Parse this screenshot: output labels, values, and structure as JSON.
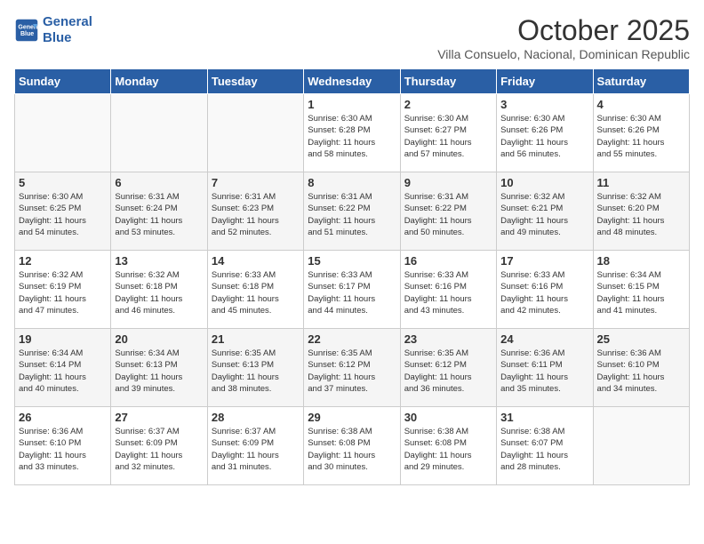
{
  "header": {
    "logo_line1": "General",
    "logo_line2": "Blue",
    "month": "October 2025",
    "location": "Villa Consuelo, Nacional, Dominican Republic"
  },
  "days_of_week": [
    "Sunday",
    "Monday",
    "Tuesday",
    "Wednesday",
    "Thursday",
    "Friday",
    "Saturday"
  ],
  "weeks": [
    [
      {
        "day": "",
        "info": ""
      },
      {
        "day": "",
        "info": ""
      },
      {
        "day": "",
        "info": ""
      },
      {
        "day": "1",
        "info": "Sunrise: 6:30 AM\nSunset: 6:28 PM\nDaylight: 11 hours\nand 58 minutes."
      },
      {
        "day": "2",
        "info": "Sunrise: 6:30 AM\nSunset: 6:27 PM\nDaylight: 11 hours\nand 57 minutes."
      },
      {
        "day": "3",
        "info": "Sunrise: 6:30 AM\nSunset: 6:26 PM\nDaylight: 11 hours\nand 56 minutes."
      },
      {
        "day": "4",
        "info": "Sunrise: 6:30 AM\nSunset: 6:26 PM\nDaylight: 11 hours\nand 55 minutes."
      }
    ],
    [
      {
        "day": "5",
        "info": "Sunrise: 6:30 AM\nSunset: 6:25 PM\nDaylight: 11 hours\nand 54 minutes."
      },
      {
        "day": "6",
        "info": "Sunrise: 6:31 AM\nSunset: 6:24 PM\nDaylight: 11 hours\nand 53 minutes."
      },
      {
        "day": "7",
        "info": "Sunrise: 6:31 AM\nSunset: 6:23 PM\nDaylight: 11 hours\nand 52 minutes."
      },
      {
        "day": "8",
        "info": "Sunrise: 6:31 AM\nSunset: 6:22 PM\nDaylight: 11 hours\nand 51 minutes."
      },
      {
        "day": "9",
        "info": "Sunrise: 6:31 AM\nSunset: 6:22 PM\nDaylight: 11 hours\nand 50 minutes."
      },
      {
        "day": "10",
        "info": "Sunrise: 6:32 AM\nSunset: 6:21 PM\nDaylight: 11 hours\nand 49 minutes."
      },
      {
        "day": "11",
        "info": "Sunrise: 6:32 AM\nSunset: 6:20 PM\nDaylight: 11 hours\nand 48 minutes."
      }
    ],
    [
      {
        "day": "12",
        "info": "Sunrise: 6:32 AM\nSunset: 6:19 PM\nDaylight: 11 hours\nand 47 minutes."
      },
      {
        "day": "13",
        "info": "Sunrise: 6:32 AM\nSunset: 6:18 PM\nDaylight: 11 hours\nand 46 minutes."
      },
      {
        "day": "14",
        "info": "Sunrise: 6:33 AM\nSunset: 6:18 PM\nDaylight: 11 hours\nand 45 minutes."
      },
      {
        "day": "15",
        "info": "Sunrise: 6:33 AM\nSunset: 6:17 PM\nDaylight: 11 hours\nand 44 minutes."
      },
      {
        "day": "16",
        "info": "Sunrise: 6:33 AM\nSunset: 6:16 PM\nDaylight: 11 hours\nand 43 minutes."
      },
      {
        "day": "17",
        "info": "Sunrise: 6:33 AM\nSunset: 6:16 PM\nDaylight: 11 hours\nand 42 minutes."
      },
      {
        "day": "18",
        "info": "Sunrise: 6:34 AM\nSunset: 6:15 PM\nDaylight: 11 hours\nand 41 minutes."
      }
    ],
    [
      {
        "day": "19",
        "info": "Sunrise: 6:34 AM\nSunset: 6:14 PM\nDaylight: 11 hours\nand 40 minutes."
      },
      {
        "day": "20",
        "info": "Sunrise: 6:34 AM\nSunset: 6:13 PM\nDaylight: 11 hours\nand 39 minutes."
      },
      {
        "day": "21",
        "info": "Sunrise: 6:35 AM\nSunset: 6:13 PM\nDaylight: 11 hours\nand 38 minutes."
      },
      {
        "day": "22",
        "info": "Sunrise: 6:35 AM\nSunset: 6:12 PM\nDaylight: 11 hours\nand 37 minutes."
      },
      {
        "day": "23",
        "info": "Sunrise: 6:35 AM\nSunset: 6:12 PM\nDaylight: 11 hours\nand 36 minutes."
      },
      {
        "day": "24",
        "info": "Sunrise: 6:36 AM\nSunset: 6:11 PM\nDaylight: 11 hours\nand 35 minutes."
      },
      {
        "day": "25",
        "info": "Sunrise: 6:36 AM\nSunset: 6:10 PM\nDaylight: 11 hours\nand 34 minutes."
      }
    ],
    [
      {
        "day": "26",
        "info": "Sunrise: 6:36 AM\nSunset: 6:10 PM\nDaylight: 11 hours\nand 33 minutes."
      },
      {
        "day": "27",
        "info": "Sunrise: 6:37 AM\nSunset: 6:09 PM\nDaylight: 11 hours\nand 32 minutes."
      },
      {
        "day": "28",
        "info": "Sunrise: 6:37 AM\nSunset: 6:09 PM\nDaylight: 11 hours\nand 31 minutes."
      },
      {
        "day": "29",
        "info": "Sunrise: 6:38 AM\nSunset: 6:08 PM\nDaylight: 11 hours\nand 30 minutes."
      },
      {
        "day": "30",
        "info": "Sunrise: 6:38 AM\nSunset: 6:08 PM\nDaylight: 11 hours\nand 29 minutes."
      },
      {
        "day": "31",
        "info": "Sunrise: 6:38 AM\nSunset: 6:07 PM\nDaylight: 11 hours\nand 28 minutes."
      },
      {
        "day": "",
        "info": ""
      }
    ]
  ]
}
